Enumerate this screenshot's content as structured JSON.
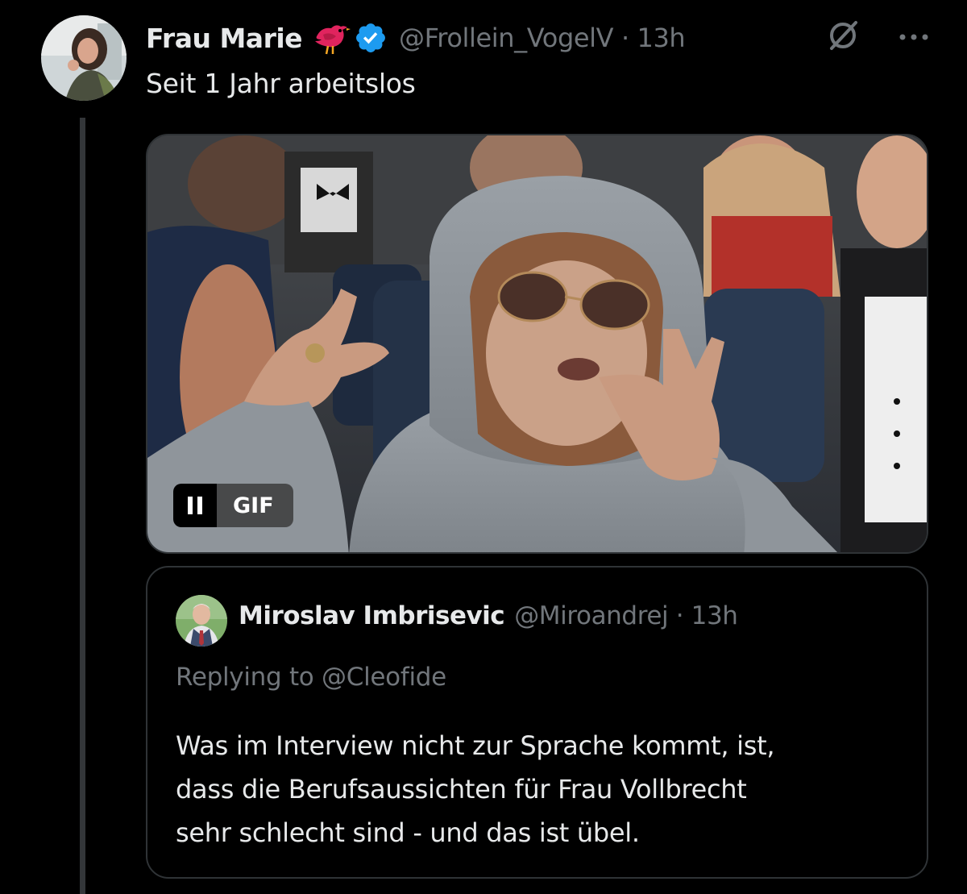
{
  "post": {
    "display_name": "Frau Marie",
    "name_emoji_icon": "red-bird-icon",
    "verified_icon": "verified-badge-icon",
    "handle": "@Frollein_VogelV",
    "separator": "·",
    "time": "13h",
    "text": "Seit 1 Jahr arbeitslos"
  },
  "media": {
    "type": "GIF",
    "pause_label": "II",
    "gif_label": "GIF"
  },
  "quote": {
    "display_name": "Miroslav Imbrisevic",
    "handle": "@Miroandrej",
    "separator": "·",
    "time": "13h",
    "replying_prefix": "Replying to",
    "replying_handle": "@Cleofide",
    "lines": [
      "Was im Interview nicht zur Sprache kommt, ist,",
      "dass die Berufsaussichten für Frau Vollbrecht",
      "sehr schlecht sind - und das ist übel."
    ]
  },
  "colors": {
    "background": "#000000",
    "primary_text": "#e7e9ea",
    "secondary_text": "#71767b",
    "border": "#2f3336",
    "verified": "#1d9bf0",
    "bird_red": "#e0245e"
  }
}
